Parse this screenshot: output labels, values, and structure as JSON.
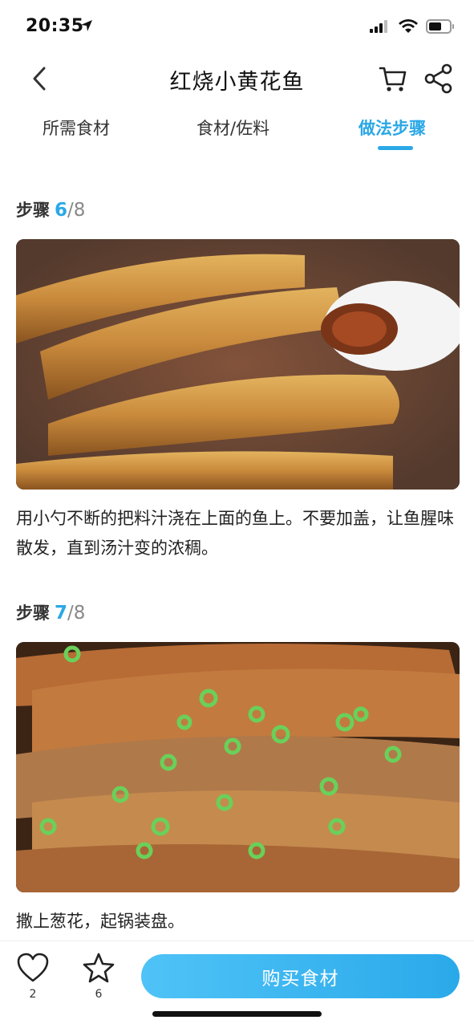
{
  "status": {
    "time": "20:35"
  },
  "header": {
    "title": "红烧小黄花鱼"
  },
  "tabs": [
    {
      "label": "所需食材"
    },
    {
      "label": "食材/佐料"
    },
    {
      "label": "做法步骤"
    }
  ],
  "steps": [
    {
      "label": "步骤",
      "number": "6",
      "separator": "/",
      "total": "8",
      "description": "用小勺不断的把料汁浇在上面的鱼上。不要加盖，让鱼腥味散发，直到汤汁变的浓稠。"
    },
    {
      "label": "步骤",
      "number": "7",
      "separator": "/",
      "total": "8",
      "description": "撒上葱花，起锅装盘。"
    }
  ],
  "bottom": {
    "like_count": "2",
    "fav_count": "6",
    "buy_label": "购买食材"
  },
  "icons": [
    "location-arrow-icon",
    "signal-icon",
    "wifi-icon",
    "battery-icon",
    "back-icon",
    "cart-icon",
    "share-icon",
    "heart-icon",
    "star-icon"
  ],
  "colors": {
    "accent": "#2ba8e6",
    "button": "#37b1ee"
  }
}
